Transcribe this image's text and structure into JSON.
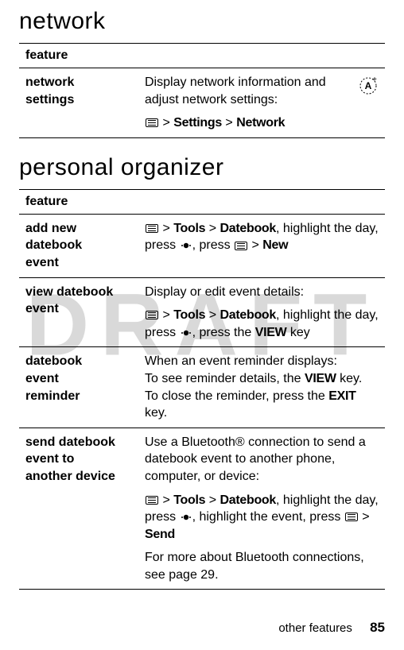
{
  "watermark": "DRAFT",
  "headings": {
    "network": "network",
    "personal_organizer": "personal organizer"
  },
  "tableHeader": "feature",
  "network_table": {
    "row1": {
      "label_l1": "network",
      "label_l2": "settings",
      "desc": "Display network information and adjust network settings:",
      "path": {
        "settings": "Settings",
        "network": "Network"
      }
    }
  },
  "organizer_table": {
    "row1": {
      "label_l1": "add new",
      "label_l2": "datebook",
      "label_l3": "event",
      "path": {
        "tools": "Tools",
        "datebook": "Datebook",
        "rest": ", highlight the day, press ",
        "press": ", press ",
        "new": "New"
      }
    },
    "row2": {
      "label_l1": "view datebook",
      "label_l2": "event",
      "desc": "Display or edit event details:",
      "path": {
        "tools": "Tools",
        "datebook": "Datebook",
        "rest": ", highlight the day, press ",
        "press2": ", press the ",
        "viewkey": "VIEW",
        "key": " key"
      }
    },
    "row3": {
      "label_l1": "datebook",
      "label_l2": "event",
      "label_l3": "reminder",
      "line1": "When an event reminder displays:",
      "line2a": "To see reminder details, the ",
      "viewkey": "VIEW",
      "line2b": " key.",
      "line3a": "To close the reminder, press the ",
      "exitkey": "EXIT",
      "line3b": " key."
    },
    "row4": {
      "label_l1": "send datebook",
      "label_l2": "event to",
      "label_l3": "another device",
      "desc": "Use a Bluetooth® connection to send a datebook event to another phone, computer, or device:",
      "path": {
        "tools": "Tools",
        "datebook": "Datebook",
        "rest": ", highlight the day, press ",
        "rest2": ", highlight the event, press ",
        "send": "Send"
      },
      "more": "For more about Bluetooth connections, see page 29."
    }
  },
  "footer": {
    "section": "other features",
    "page": "85"
  },
  "gt": ">"
}
